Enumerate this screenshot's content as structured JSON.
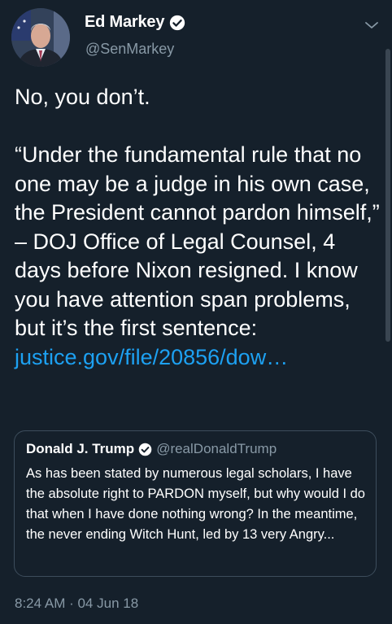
{
  "author": {
    "display_name": "Ed Markey",
    "handle": "@SenMarkey"
  },
  "tweet": {
    "line1": "No, you don’t.",
    "body": "“Under the fundamental rule that no one may be a judge in his own case, the President cannot pardon himself,” – DOJ Office of Legal Counsel, 4 days before Nixon resigned. I know you have attention span problems, but it’s the first sentence: ",
    "link_text": "justice.gov/file/20856/dow…"
  },
  "quoted_tweet": {
    "display_name": "Donald J. Trump",
    "handle": "@realDonaldTrump",
    "text": "As has been stated by numerous legal scholars, I have the absolute right to PARDON myself, but why would I do that when I have done nothing wrong? In the meantime, the never ending Witch Hunt, led by 13 very Angry..."
  },
  "timestamp": "8:24 AM · 04 Jun 18",
  "colors": {
    "background": "#15202b",
    "link": "#1da1f2",
    "secondary_text": "#8899a6",
    "verified_badge": "#ffffff"
  },
  "icons": {
    "verified": "verified-badge-icon",
    "menu": "chevron-down-icon"
  }
}
